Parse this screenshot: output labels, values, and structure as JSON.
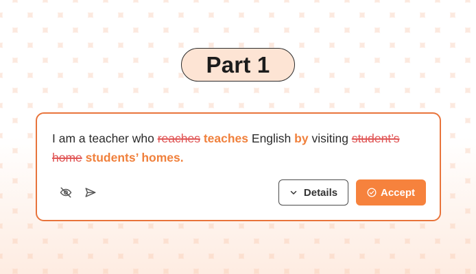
{
  "title": "Part 1",
  "sentence": {
    "t1": "I am a teacher who ",
    "del1": "reaches",
    "ins1": "teaches",
    "t2": " English ",
    "ins2": "by",
    "t3": " visiting ",
    "del2": "student’s home",
    "ins3": "students’ homes."
  },
  "icons": {
    "hide": "eye-off-icon",
    "send": "send-icon",
    "details": "chevron-down-icon",
    "accept": "check-circle-icon"
  },
  "buttons": {
    "details_label": "Details",
    "accept_label": "Accept"
  },
  "colors": {
    "accent": "#f6823d",
    "deleted": "#e05555",
    "card_border": "#e8733a"
  }
}
